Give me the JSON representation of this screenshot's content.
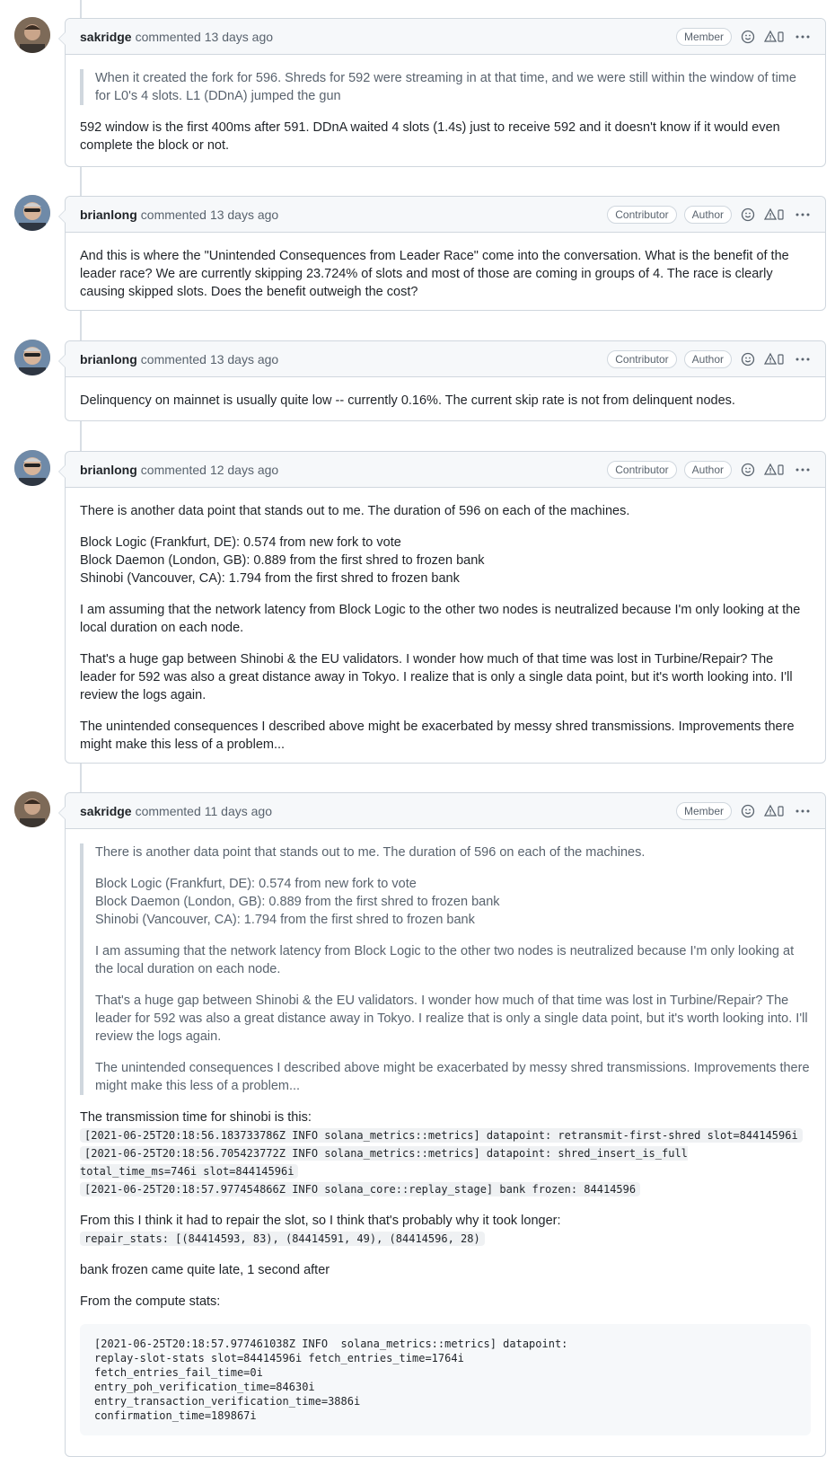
{
  "comments": [
    {
      "author": "sakridge",
      "action": "commented",
      "time": "13 days ago",
      "badges": [
        "Member"
      ],
      "quote": [
        "When it created the fork for 596. Shreds for 592 were streaming in at that time, and we were still within the window of time for L0's 4 slots. L1 (DDnA) jumped the gun"
      ],
      "paragraphs": [
        "592 window is the first 400ms after 591. DDnA waited 4 slots (1.4s) just to receive 592 and it doesn't know if it would even complete the block or not."
      ]
    },
    {
      "author": "brianlong",
      "action": "commented",
      "time": "13 days ago",
      "badges": [
        "Contributor",
        "Author"
      ],
      "paragraphs": [
        "And this is where the \"Unintended Consequences from Leader Race\" come into the conversation. What is the benefit of the leader race? We are currently skipping 23.724% of slots and most of those are coming in groups of 4. The race is clearly causing skipped slots. Does the benefit outweigh the cost?"
      ]
    },
    {
      "author": "brianlong",
      "action": "commented",
      "time": "13 days ago",
      "badges": [
        "Contributor",
        "Author"
      ],
      "paragraphs": [
        "Delinquency on mainnet is usually quite low -- currently 0.16%. The current skip rate is not from delinquent nodes."
      ]
    },
    {
      "author": "brianlong",
      "action": "commented",
      "time": "12 days ago",
      "badges": [
        "Contributor",
        "Author"
      ],
      "paragraphs": [
        "There is another data point that stands out to me. The duration of 596 on each of the machines.",
        "Block Logic (Frankfurt, DE): 0.574 from new fork to vote",
        "Block Daemon (London, GB): 0.889 from the first shred to frozen bank",
        "Shinobi (Vancouver, CA): 1.794 from the first shred to frozen bank",
        "I am assuming that the network latency from Block Logic to the other two nodes is neutralized because I'm only looking at the local duration on each node.",
        "That's a huge gap between Shinobi & the EU validators. I wonder how much of that time was lost in Turbine/Repair? The leader for 592 was also a great distance away in Tokyo. I realize that is only a single data point, but it's worth looking into. I'll review the logs again.",
        "The unintended consequences I described above might be exacerbated by messy shred transmissions. Improvements there might make this less of a problem..."
      ]
    },
    {
      "author": "sakridge",
      "action": "commented",
      "time": "11 days ago",
      "badges": [
        "Member"
      ],
      "quote": [
        "There is another data point that stands out to me. The duration of 596 on each of the machines.",
        "Block Logic (Frankfurt, DE): 0.574 from new fork to vote",
        "Block Daemon (London, GB): 0.889 from the first shred to frozen bank",
        "Shinobi (Vancouver, CA): 1.794 from the first shred to frozen bank",
        "I am assuming that the network latency from Block Logic to the other two nodes is neutralized because I'm only looking at the local duration on each node.",
        "That's a huge gap between Shinobi & the EU validators. I wonder how much of that time was lost in Turbine/Repair? The leader for 592 was also a great distance away in Tokyo. I realize that is only a single data point, but it's worth looking into. I'll review the logs again.",
        "The unintended consequences I described above might be exacerbated by messy shred transmissions. Improvements there might make this less of a problem..."
      ],
      "transmission_label": "The transmission time for shinobi is this:",
      "log_lines": [
        "[2021-06-25T20:18:56.183733786Z INFO solana_metrics::metrics] datapoint: retransmit-first-shred slot=84414596i",
        "[2021-06-25T20:18:56.705423772Z INFO solana_metrics::metrics] datapoint: shred_insert_is_full total_time_ms=746i slot=84414596i",
        "[2021-06-25T20:18:57.977454866Z INFO solana_core::replay_stage] bank frozen: 84414596"
      ],
      "repair_label": "From this I think it had to repair the slot, so I think that's probably why it took longer:",
      "repair_code": "repair_stats: [(84414593, 83), (84414591, 49), (84414596, 28)",
      "bank_frozen_text": "bank frozen came quite late, 1 second after",
      "compute_label": "From the compute stats:",
      "compute_block": [
        "[2021-06-25T20:18:57.977461038Z INFO  solana_metrics::metrics] datapoint:",
        "replay-slot-stats slot=84414596i fetch_entries_time=1764i",
        "fetch_entries_fail_time=0i",
        "entry_poh_verification_time=84630i",
        "entry_transaction_verification_time=3886i",
        "confirmation_time=189867i"
      ]
    }
  ]
}
